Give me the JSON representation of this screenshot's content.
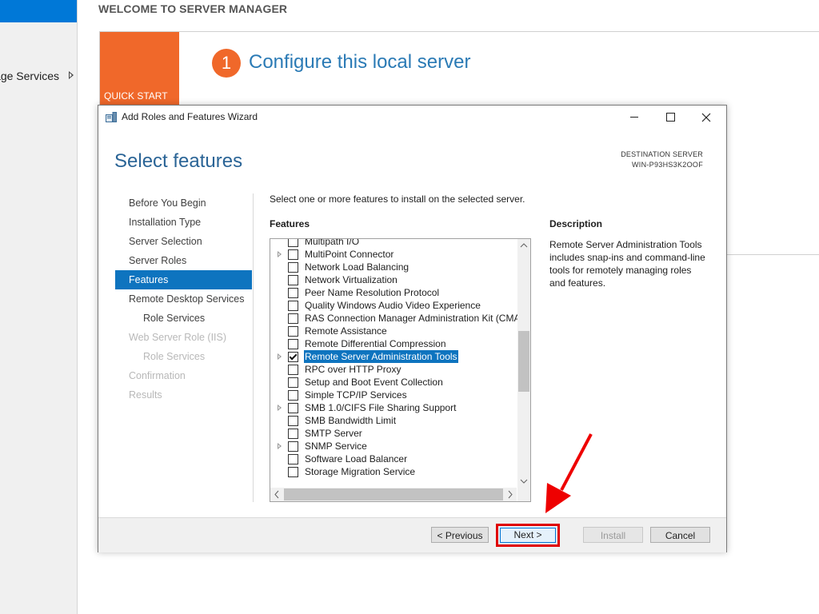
{
  "background": {
    "nav_partial_label": "age Services",
    "welcome_title": "WELCOME TO SERVER MANAGER",
    "quick_start_label": "QUICK START",
    "step_number": "1",
    "step_text": "Configure this local server"
  },
  "wizard": {
    "window_title": "Add Roles and Features Wizard",
    "page_heading": "Select features",
    "destination_label": "DESTINATION SERVER",
    "destination_name": "WIN-P93HS3K2OOF",
    "steps": [
      {
        "label": "Before You Begin",
        "state": "normal"
      },
      {
        "label": "Installation Type",
        "state": "normal"
      },
      {
        "label": "Server Selection",
        "state": "normal"
      },
      {
        "label": "Server Roles",
        "state": "normal"
      },
      {
        "label": "Features",
        "state": "active"
      },
      {
        "label": "Remote Desktop Services",
        "state": "normal"
      },
      {
        "label": "Role Services",
        "state": "normal"
      },
      {
        "label": "Web Server Role (IIS)",
        "state": "disabled"
      },
      {
        "label": "Role Services",
        "state": "disabled"
      },
      {
        "label": "Confirmation",
        "state": "disabled"
      },
      {
        "label": "Results",
        "state": "disabled"
      }
    ],
    "instruction": "Select one or more features to install on the selected server.",
    "features_label": "Features",
    "description_label": "Description",
    "description_text": "Remote Server Administration Tools includes snap-ins and command-line tools for remotely managing roles and features.",
    "features": [
      {
        "label": "Multipath I/O",
        "expandable": false,
        "checked": false
      },
      {
        "label": "MultiPoint Connector",
        "expandable": true,
        "checked": false
      },
      {
        "label": "Network Load Balancing",
        "expandable": false,
        "checked": false
      },
      {
        "label": "Network Virtualization",
        "expandable": false,
        "checked": false
      },
      {
        "label": "Peer Name Resolution Protocol",
        "expandable": false,
        "checked": false
      },
      {
        "label": "Quality Windows Audio Video Experience",
        "expandable": false,
        "checked": false
      },
      {
        "label": "RAS Connection Manager Administration Kit (CMA",
        "expandable": false,
        "checked": false
      },
      {
        "label": "Remote Assistance",
        "expandable": false,
        "checked": false
      },
      {
        "label": "Remote Differential Compression",
        "expandable": false,
        "checked": false
      },
      {
        "label": "Remote Server Administration Tools",
        "expandable": true,
        "checked": true,
        "selected": true
      },
      {
        "label": "RPC over HTTP Proxy",
        "expandable": false,
        "checked": false
      },
      {
        "label": "Setup and Boot Event Collection",
        "expandable": false,
        "checked": false
      },
      {
        "label": "Simple TCP/IP Services",
        "expandable": false,
        "checked": false
      },
      {
        "label": "SMB 1.0/CIFS File Sharing Support",
        "expandable": true,
        "checked": false
      },
      {
        "label": "SMB Bandwidth Limit",
        "expandable": false,
        "checked": false
      },
      {
        "label": "SMTP Server",
        "expandable": false,
        "checked": false
      },
      {
        "label": "SNMP Service",
        "expandable": true,
        "checked": false
      },
      {
        "label": "Software Load Balancer",
        "expandable": false,
        "checked": false
      },
      {
        "label": "Storage Migration Service",
        "expandable": false,
        "checked": false
      }
    ],
    "buttons": {
      "previous": "< Previous",
      "next": "Next >",
      "install": "Install",
      "cancel": "Cancel"
    }
  },
  "colors": {
    "accent_blue": "#0e74bf",
    "quick_start_orange": "#f0682a",
    "highlight_red": "#e00000",
    "heading_blue": "#2a6496"
  }
}
